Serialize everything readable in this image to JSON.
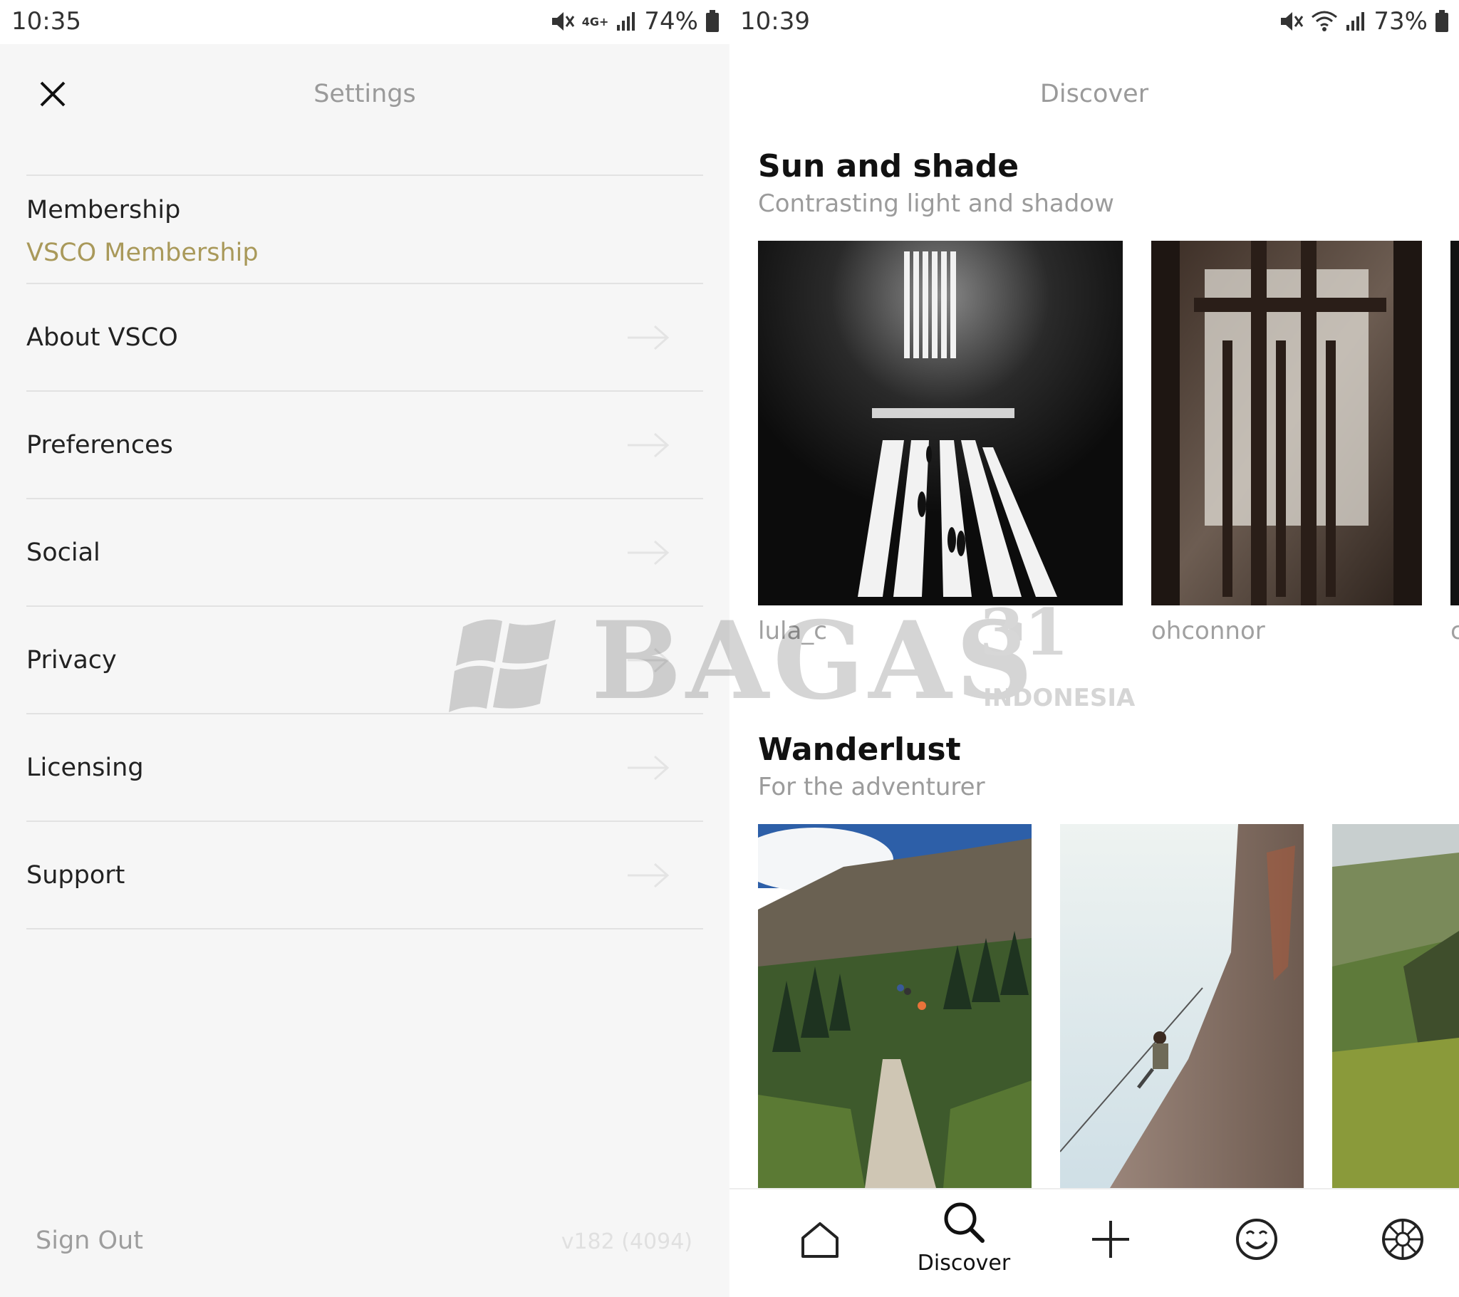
{
  "settings_screen": {
    "status": {
      "time": "10:35",
      "network": "4G+",
      "battery": "74%"
    },
    "title": "Settings",
    "membership": {
      "label": "Membership",
      "value": "VSCO Membership"
    },
    "items": [
      {
        "label": "About VSCO"
      },
      {
        "label": "Preferences"
      },
      {
        "label": "Social"
      },
      {
        "label": "Privacy"
      },
      {
        "label": "Licensing"
      },
      {
        "label": "Support"
      }
    ],
    "sign_out": "Sign Out",
    "version": "v182 (4094)",
    "colors": {
      "accent": "#a9995a",
      "background": "#f6f6f6",
      "divider": "#e2e2e2"
    }
  },
  "discover_screen": {
    "status": {
      "time": "10:39",
      "battery": "73%"
    },
    "title": "Discover",
    "sections": [
      {
        "title": "Sun and shade",
        "subtitle": "Contrasting light and shadow",
        "credits": [
          "lula_c",
          "ohconnor",
          "c"
        ]
      },
      {
        "title": "Wanderlust",
        "subtitle": "For the adventurer"
      }
    ],
    "nav": {
      "items": [
        {
          "icon": "home-icon"
        },
        {
          "icon": "search-icon",
          "label": "Discover"
        },
        {
          "icon": "plus-icon"
        },
        {
          "icon": "smiley-icon"
        },
        {
          "icon": "aperture-icon"
        }
      ]
    }
  },
  "watermark": {
    "text": "BAGAS",
    "number": "31",
    "sub": "INDONESIA"
  }
}
